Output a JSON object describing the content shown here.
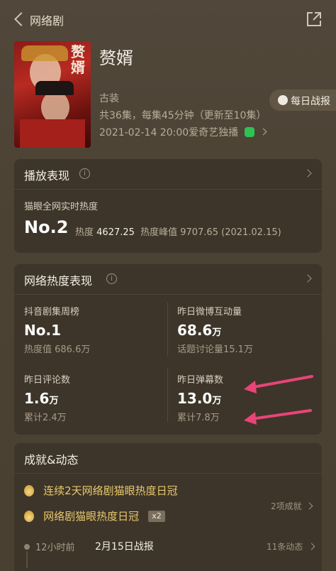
{
  "header": {
    "back_label": "网络剧"
  },
  "show": {
    "title": "赘婿",
    "poster_text": "赘婿",
    "genre": "古装",
    "episodes": "共36集，每集45分钟（更新至10集）",
    "air_info": "2021-02-14 20:00爱奇艺独播",
    "daily_report": "每日战报"
  },
  "playback": {
    "title": "播放表现",
    "subtitle": "猫眼全网实时热度",
    "rank": "No.2",
    "heat_label": "热度",
    "heat_value": "4627.25",
    "peak_label": "热度峰值",
    "peak_value": "9707.65",
    "peak_date": "(2021.02.15)"
  },
  "network": {
    "title": "网络热度表现",
    "stats": [
      {
        "label": "抖音剧集周榜",
        "value": "No.1",
        "unit": "",
        "sub": "热度值 686.6万"
      },
      {
        "label": "昨日微博互动量",
        "value": "68.6",
        "unit": "万",
        "sub": "话题讨论量15.1万"
      },
      {
        "label": "昨日评论数",
        "value": "1.6",
        "unit": "万",
        "sub": "累计2.4万"
      },
      {
        "label": "昨日弹幕数",
        "value": "13.0",
        "unit": "万",
        "sub": "累计7.8万"
      }
    ]
  },
  "achievements": {
    "title": "成就&动态",
    "items": [
      {
        "text": "连续2天网络剧猫眼热度日冠",
        "badge": ""
      },
      {
        "text": "网络剧猫眼热度日冠",
        "badge": "x2"
      }
    ],
    "count": "2项成就",
    "timeline": {
      "time": "12小时前",
      "title": "2月15日战报",
      "count": "11条动态"
    }
  },
  "colors": {
    "accent_gold": "#e8c86e",
    "arrow_pink": "#e8447a",
    "card_bg": "#3d3529"
  }
}
